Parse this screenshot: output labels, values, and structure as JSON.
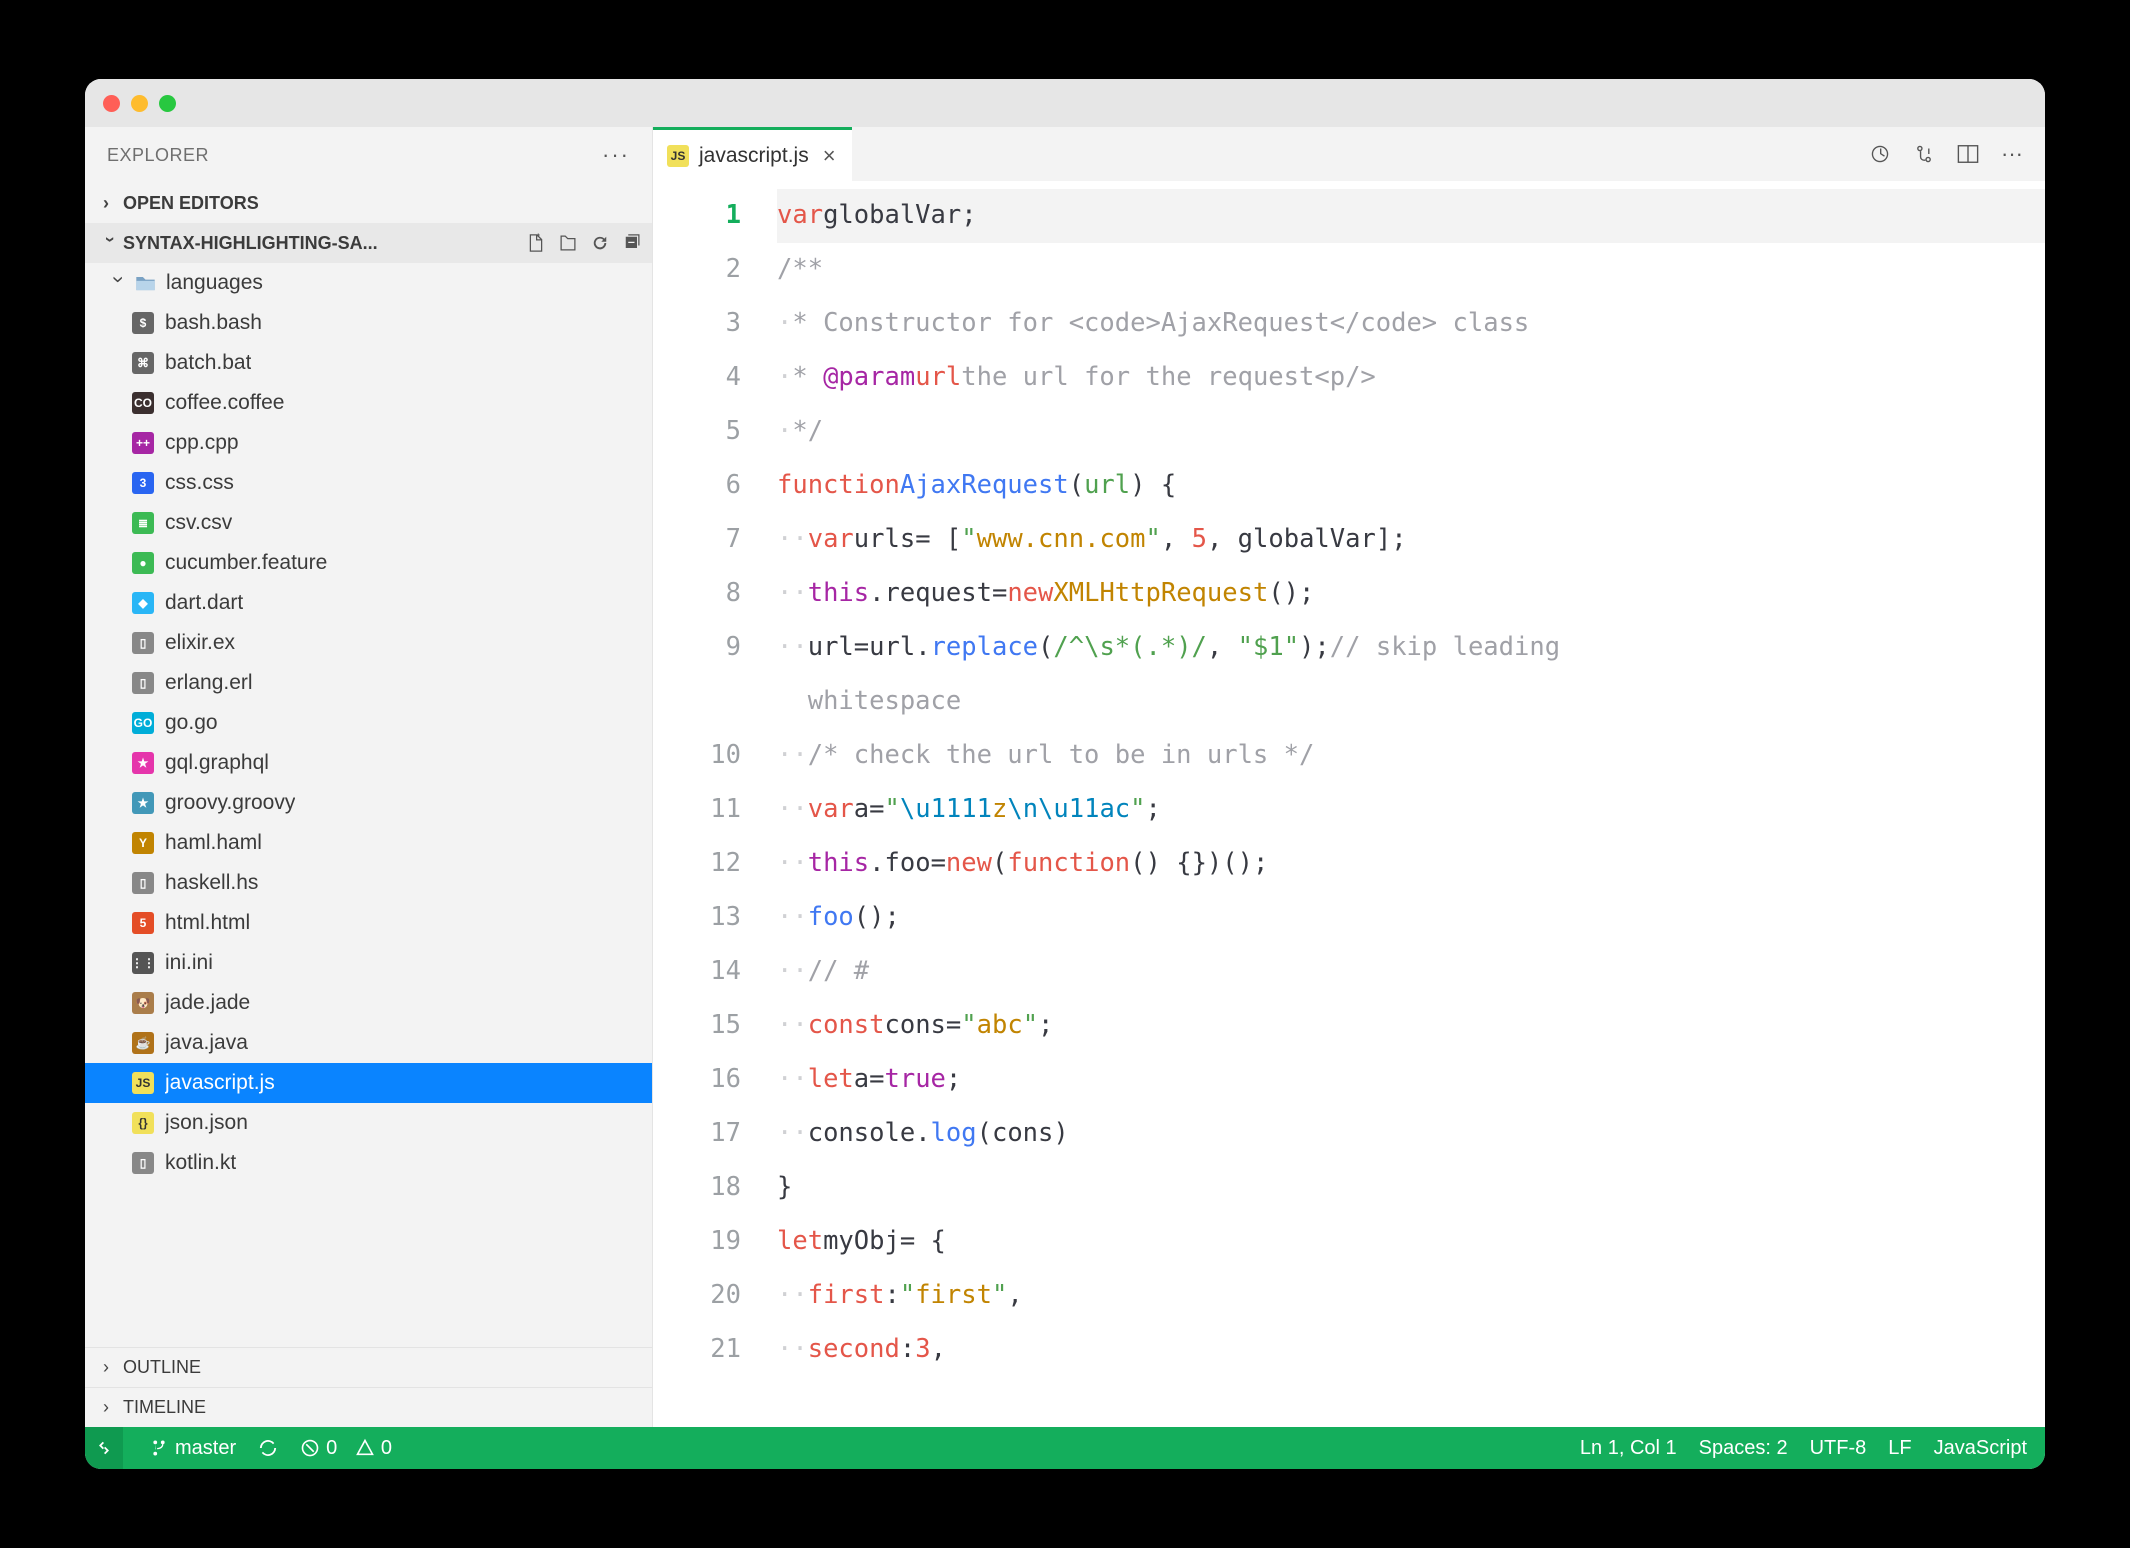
{
  "sidebar": {
    "title": "EXPLORER",
    "open_editors": "OPEN EDITORS",
    "repo": "SYNTAX-HIGHLIGHTING-SA...",
    "folder": "languages",
    "files": [
      {
        "name": "bash.bash",
        "icon": "$",
        "color": "#666"
      },
      {
        "name": "batch.bat",
        "icon": "⌘",
        "color": "#666"
      },
      {
        "name": "coffee.coffee",
        "icon": "CO",
        "color": "#3b2f2f"
      },
      {
        "name": "cpp.cpp",
        "icon": "++",
        "color": "#a626a4"
      },
      {
        "name": "css.css",
        "icon": "3",
        "color": "#2965f1"
      },
      {
        "name": "csv.csv",
        "icon": "≣",
        "color": "#3cba54"
      },
      {
        "name": "cucumber.feature",
        "icon": "●",
        "color": "#3cba54"
      },
      {
        "name": "dart.dart",
        "icon": "◆",
        "color": "#29b6f6"
      },
      {
        "name": "elixir.ex",
        "icon": "▯",
        "color": "#888"
      },
      {
        "name": "erlang.erl",
        "icon": "▯",
        "color": "#888"
      },
      {
        "name": "go.go",
        "icon": "GO",
        "color": "#00add8"
      },
      {
        "name": "gql.graphql",
        "icon": "★",
        "color": "#e535ab"
      },
      {
        "name": "groovy.groovy",
        "icon": "★",
        "color": "#4298b8"
      },
      {
        "name": "haml.haml",
        "icon": "Y",
        "color": "#c18401"
      },
      {
        "name": "haskell.hs",
        "icon": "▯",
        "color": "#888"
      },
      {
        "name": "html.html",
        "icon": "5",
        "color": "#e44d26"
      },
      {
        "name": "ini.ini",
        "icon": "⋮⋮",
        "color": "#555"
      },
      {
        "name": "jade.jade",
        "icon": "🐶",
        "color": "#aa7d4a"
      },
      {
        "name": "java.java",
        "icon": "☕",
        "color": "#b07219"
      },
      {
        "name": "javascript.js",
        "icon": "JS",
        "color": "#f1e05a",
        "selected": true
      },
      {
        "name": "json.json",
        "icon": "{}",
        "color": "#f1e05a"
      },
      {
        "name": "kotlin.kt",
        "icon": "▯",
        "color": "#888"
      }
    ],
    "outline": "OUTLINE",
    "timeline": "TIMELINE"
  },
  "tab": {
    "icon": "JS",
    "label": "javascript.js"
  },
  "code": {
    "lines": 21,
    "l9_tail": "whitespace"
  },
  "status": {
    "branch": "master",
    "errors": "0",
    "warnings": "0",
    "pos": "Ln 1, Col 1",
    "indent": "Spaces: 2",
    "encoding": "UTF-8",
    "eol": "LF",
    "lang": "JavaScript"
  }
}
